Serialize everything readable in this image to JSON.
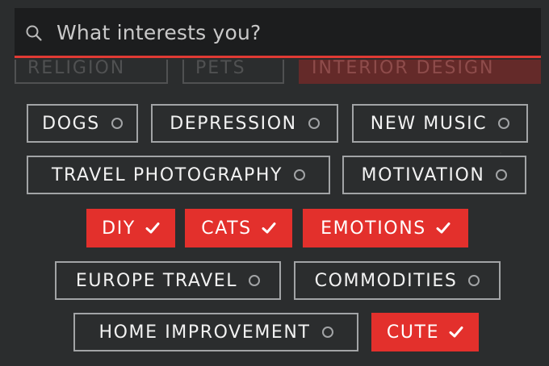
{
  "search": {
    "placeholder": "What interests you?",
    "icon": "search-icon",
    "accent": "#e03a34"
  },
  "faded_row": [
    {
      "label": "RELIGION",
      "selected": false
    },
    {
      "label": "PETS",
      "selected": false
    },
    {
      "label": "INTERIOR DESIGN",
      "selected": true
    }
  ],
  "tags": [
    {
      "label": "DOGS",
      "selected": false
    },
    {
      "label": "DEPRESSION",
      "selected": false
    },
    {
      "label": "NEW MUSIC",
      "selected": false
    },
    {
      "label": "TRAVEL PHOTOGRAPHY",
      "selected": false
    },
    {
      "label": "MOTIVATION",
      "selected": false
    },
    {
      "label": "DIY",
      "selected": true
    },
    {
      "label": "CATS",
      "selected": true
    },
    {
      "label": "EMOTIONS",
      "selected": true
    },
    {
      "label": "EUROPE TRAVEL",
      "selected": false
    },
    {
      "label": "COMMODITIES",
      "selected": false
    },
    {
      "label": "HOME IMPROVEMENT",
      "selected": false
    },
    {
      "label": "CUTE",
      "selected": true
    }
  ],
  "colors": {
    "selected_bg": "#e3302c",
    "unselected_border": "#a2a4a6",
    "background": "#2b2d2e"
  }
}
